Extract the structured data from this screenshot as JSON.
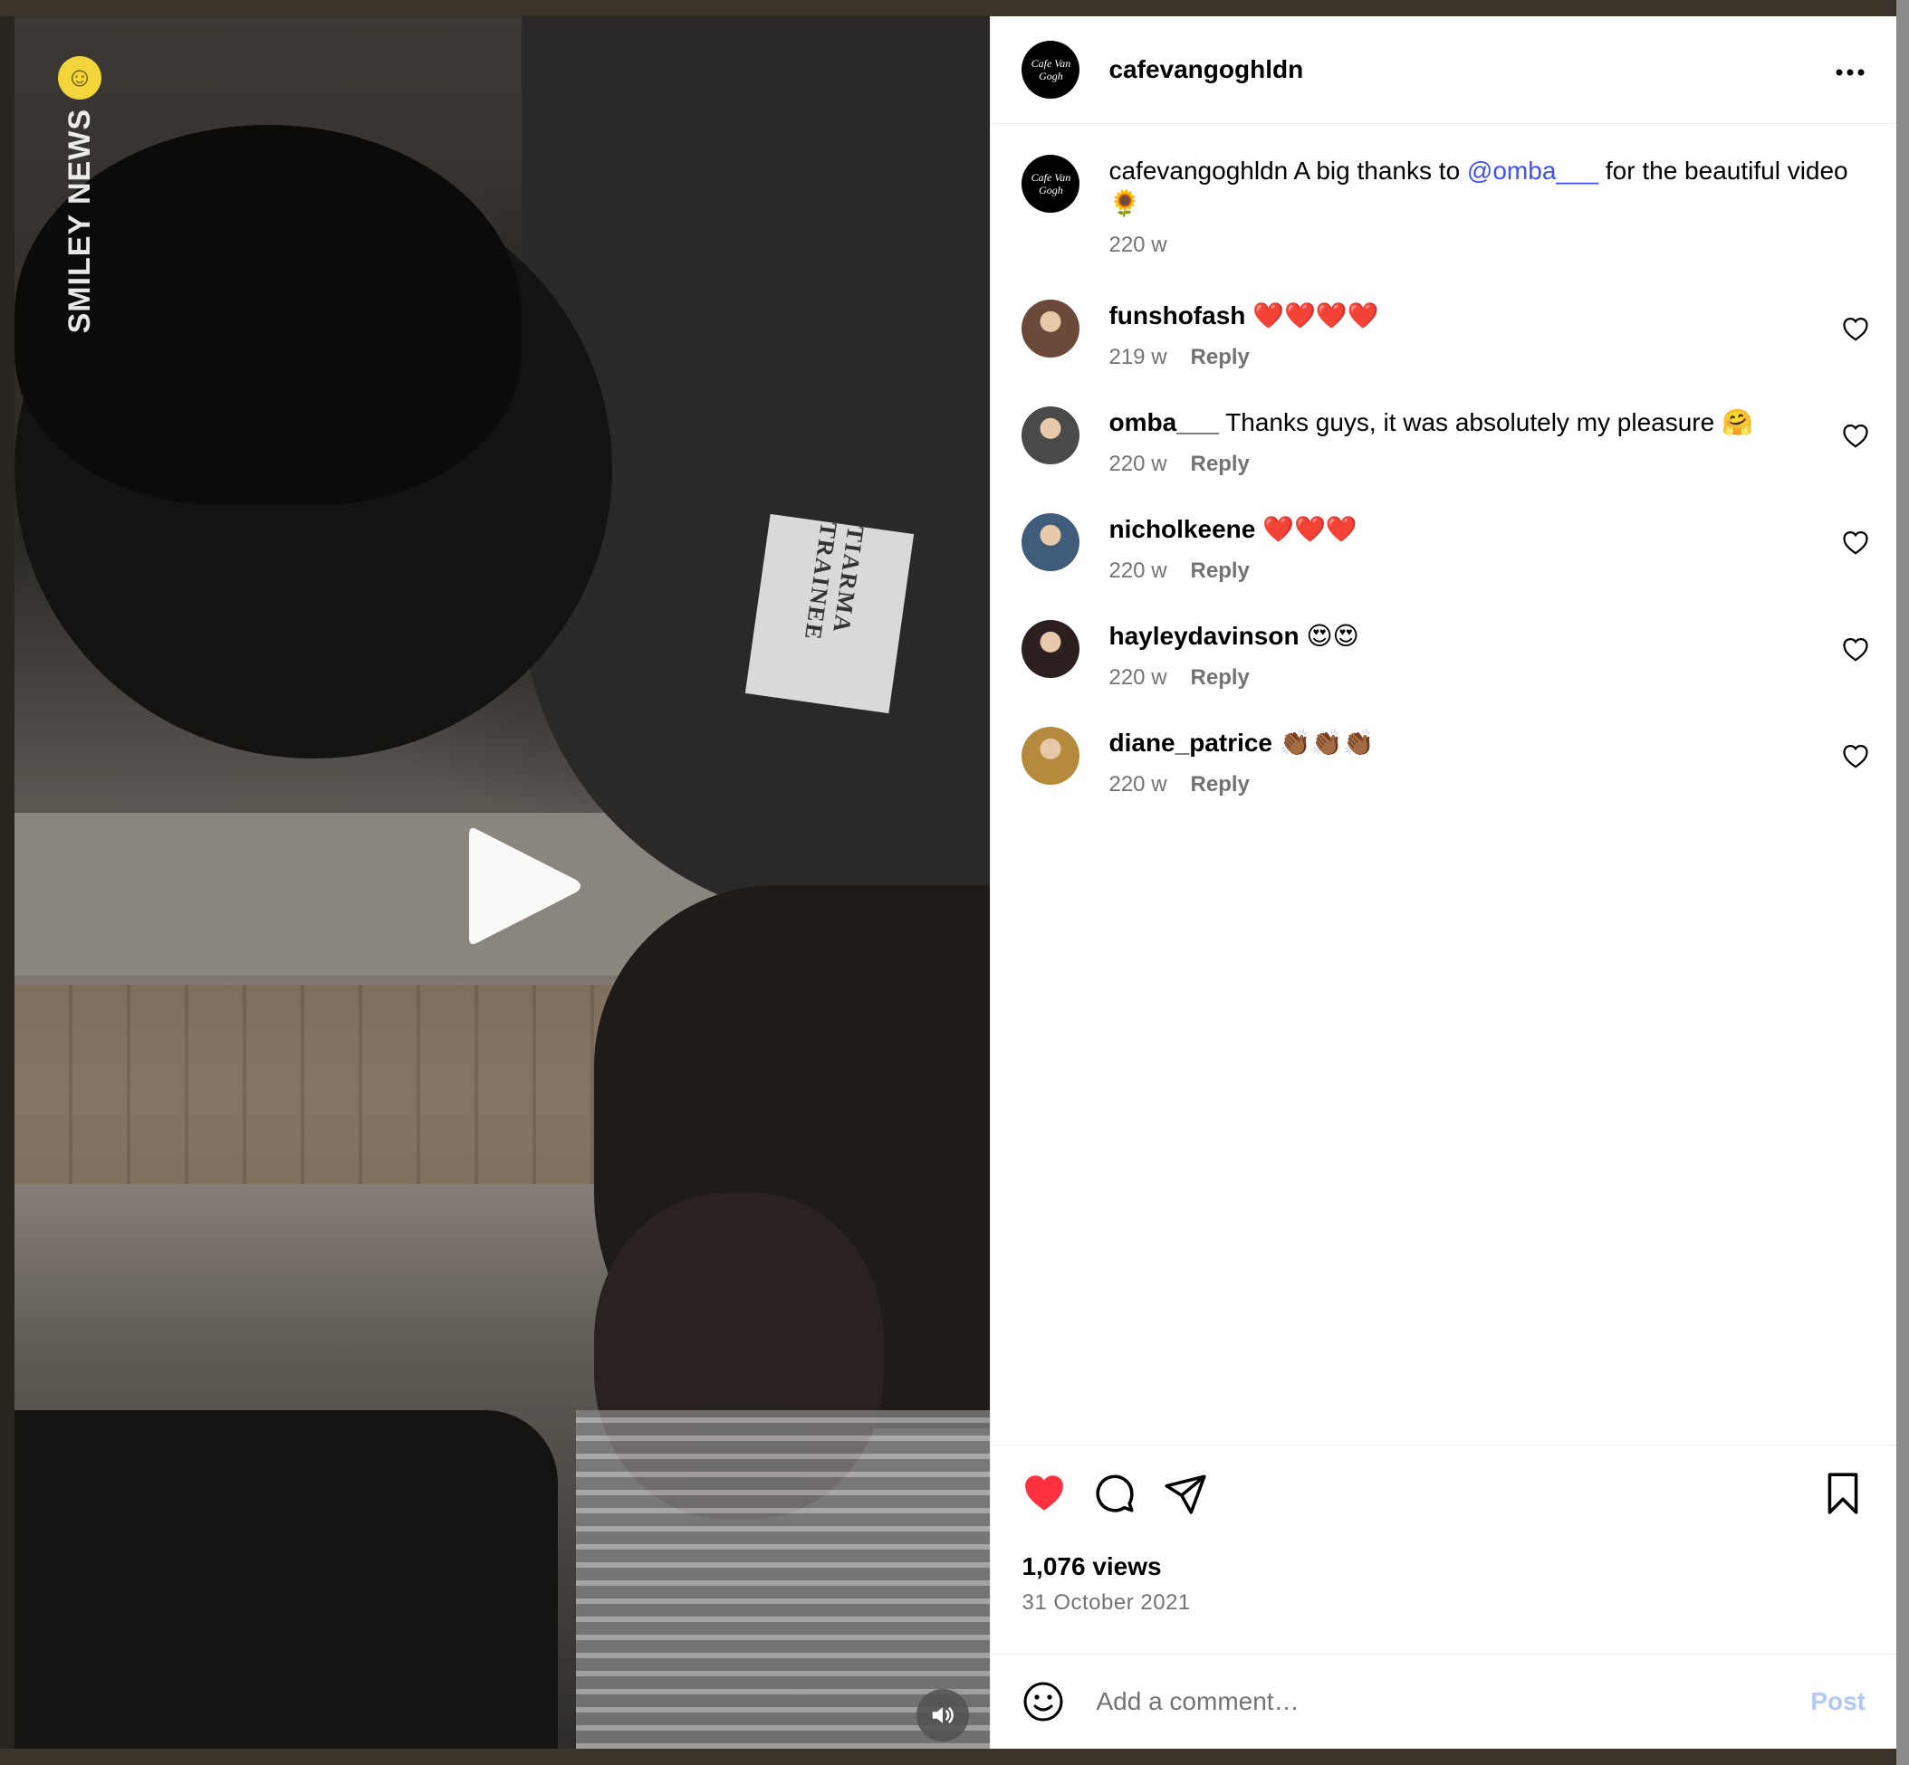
{
  "post": {
    "username": "cafevangoghldn",
    "avatar_text": "Cafe Van Gogh",
    "caption": {
      "username": "cafevangoghldn",
      "text_before": "A big thanks to",
      "mention": "@omba___",
      "text_after": "for the beautiful video 🌻",
      "time": "220 w"
    },
    "media": {
      "watermark": "SMILEY NEWS",
      "badge_text": "TIARMA TRAINEE",
      "play_icon": "play-icon",
      "mute_icon": "speaker-icon"
    }
  },
  "comments": [
    {
      "username": "funshofash",
      "text": "❤️❤️❤️❤️",
      "time": "219 w",
      "reply": "Reply",
      "avatar_color": "#6b4a3a"
    },
    {
      "username": "omba___",
      "text": "Thanks guys, it was absolutely my pleasure 🤗",
      "time": "220 w",
      "reply": "Reply",
      "avatar_color": "#4a4a4a"
    },
    {
      "username": "nicholkeene",
      "text": "❤️❤️❤️",
      "time": "220 w",
      "reply": "Reply",
      "avatar_color": "#3f5d7a"
    },
    {
      "username": "hayleydavinson",
      "text": "😍😍",
      "time": "220 w",
      "reply": "Reply",
      "avatar_color": "#2b1f1f"
    },
    {
      "username": "diane_patrice",
      "text": "👏🏾👏🏾👏🏾",
      "time": "220 w",
      "reply": "Reply",
      "avatar_color": "#b58a3c"
    }
  ],
  "actions": {
    "views": "1,076 views",
    "date": "31 October 2021",
    "like_color": "#ff3040"
  },
  "composer": {
    "placeholder": "Add a comment…",
    "post_label": "Post"
  }
}
